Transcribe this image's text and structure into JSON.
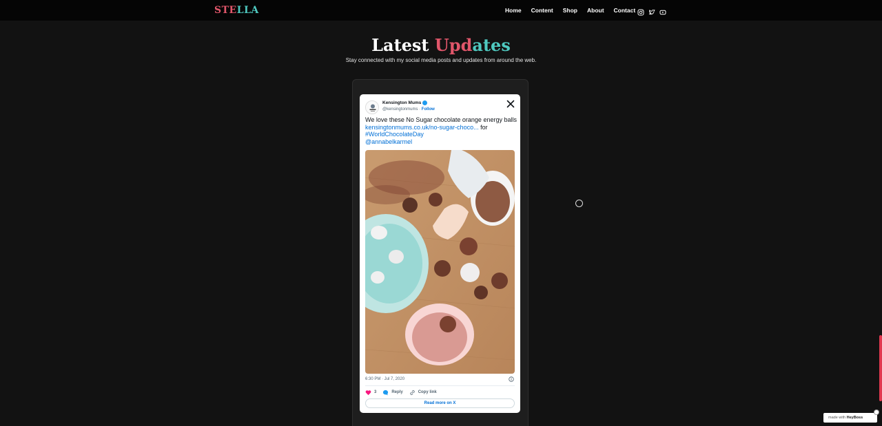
{
  "header": {
    "logo_letters": [
      {
        "ch": "S",
        "color": "#e0566a"
      },
      {
        "ch": "T",
        "color": "#e0566a"
      },
      {
        "ch": "E",
        "color": "#e0566a"
      },
      {
        "ch": "L",
        "color": "#4fc9c0"
      },
      {
        "ch": "L",
        "color": "#4fc9c0"
      },
      {
        "ch": "A",
        "color": "#4fc9c0"
      }
    ],
    "nav": [
      "Home",
      "Content",
      "Shop",
      "About",
      "Contact"
    ],
    "social_icons": [
      "instagram-icon",
      "twitter-icon",
      "youtube-icon"
    ]
  },
  "section": {
    "title_word1": "Latest",
    "title_word2_letters": [
      {
        "ch": "U",
        "color": "#e0566a"
      },
      {
        "ch": "p",
        "color": "#e0566a"
      },
      {
        "ch": "d",
        "color": "#e0566a"
      },
      {
        "ch": "a",
        "color": "#4fc9c0"
      },
      {
        "ch": "t",
        "color": "#4fc9c0"
      },
      {
        "ch": "e",
        "color": "#4fc9c0"
      },
      {
        "ch": "s",
        "color": "#4fc9c0"
      }
    ],
    "subtitle": "Stay connected with my social media posts and updates from around the web."
  },
  "tweet": {
    "author": "Kensington Mums",
    "handle": "@kensingtonmums",
    "separator": " · ",
    "follow": "Follow",
    "text_line1": "We love these No Sugar chocolate orange energy balls",
    "link_url": "kensingtonmums.co.uk/no-sugar-choco...",
    "after_link": " for",
    "hashtag": "#WorldChocolateDay",
    "mention": "@annabelkarmel",
    "timestamp": "6:30 PM · Jul 7, 2020",
    "likes": "3",
    "reply": "Reply",
    "copy_link": "Copy link",
    "read_more": "Read more on X"
  },
  "badge": {
    "made_with": "made with",
    "brand": "HeyBoss"
  }
}
